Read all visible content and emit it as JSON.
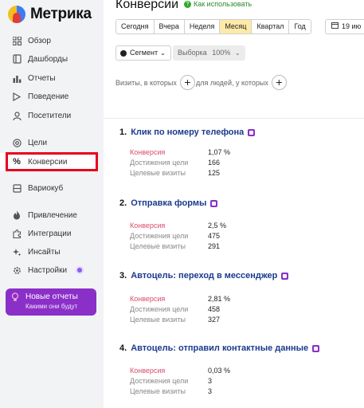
{
  "app": {
    "logo_text": "Метрика"
  },
  "sidebar": {
    "items": [
      {
        "label": "Обзор",
        "icon": "grid-icon"
      },
      {
        "label": "Дашборды",
        "icon": "dashboard-icon"
      },
      {
        "label": "Отчеты",
        "icon": "bar-chart-icon"
      },
      {
        "label": "Поведение",
        "icon": "play-icon"
      },
      {
        "label": "Посетители",
        "icon": "user-icon"
      },
      {
        "label": "Цели",
        "icon": "target-icon"
      },
      {
        "label": "Конверсии",
        "icon": "percent-icon",
        "active": true
      },
      {
        "label": "Вариокуб",
        "icon": "cube-icon"
      },
      {
        "label": "Привлечение",
        "icon": "flame-icon"
      },
      {
        "label": "Интеграции",
        "icon": "puzzle-icon"
      },
      {
        "label": "Инсайты",
        "icon": "sparkle-icon"
      },
      {
        "label": "Настройки",
        "icon": "gear-icon"
      }
    ],
    "promo": {
      "title": "Новые отчеты",
      "subtitle": "Какими они будут"
    }
  },
  "header": {
    "title": "Конверсии",
    "help_link": "Как использовать"
  },
  "period": {
    "buttons": [
      "Сегодня",
      "Вчера",
      "Неделя",
      "Месяц",
      "Квартал",
      "Год"
    ],
    "selected": "Месяц",
    "date_value": "19 ию"
  },
  "filters": {
    "segment_label": "Сегмент",
    "sample_label": "Выборка",
    "sample_value": "100%",
    "visits_label": "Визиты, в которых",
    "people_label": "для людей, у которых"
  },
  "goals": [
    {
      "num": "1.",
      "title": "Клик по номеру телефона",
      "icon": "phone-goal-icon",
      "rows": [
        {
          "label": "Конверсия",
          "value": "1,07 %"
        },
        {
          "label": "Достижения цели",
          "value": "166"
        },
        {
          "label": "Целевые визиты",
          "value": "125"
        }
      ]
    },
    {
      "num": "2.",
      "title": "Отправка формы",
      "icon": "form-goal-icon",
      "rows": [
        {
          "label": "Конверсия",
          "value": "2,5 %"
        },
        {
          "label": "Достижения цели",
          "value": "475"
        },
        {
          "label": "Целевые визиты",
          "value": "291"
        }
      ]
    },
    {
      "num": "3.",
      "title": "Автоцель: переход в мессенджер",
      "icon": "messenger-goal-icon",
      "rows": [
        {
          "label": "Конверсия",
          "value": "2,81 %"
        },
        {
          "label": "Достижения цели",
          "value": "458"
        },
        {
          "label": "Целевые визиты",
          "value": "327"
        }
      ]
    },
    {
      "num": "4.",
      "title": "Автоцель: отправил контактные данные",
      "icon": "contact-goal-icon",
      "rows": [
        {
          "label": "Конверсия",
          "value": "0,03 %"
        },
        {
          "label": "Достижения цели",
          "value": "3"
        },
        {
          "label": "Целевые визиты",
          "value": "3"
        }
      ]
    }
  ],
  "colors": {
    "accent_purple": "#8b2fc9",
    "selected_period": "#fdeaa8",
    "goal_title": "#1a3a8c",
    "conversion_label": "#d94c6a",
    "highlight_outline": "#e8001c"
  }
}
